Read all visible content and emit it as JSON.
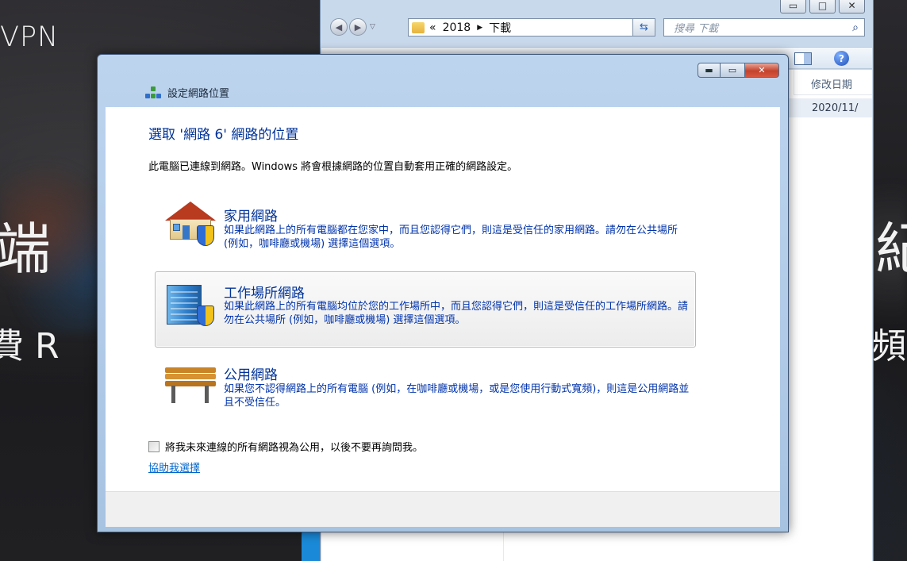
{
  "background": {
    "page_text_vpn": "VPN",
    "page_text_big_left": "端",
    "page_text_fee_left": "費 R",
    "page_text_big_right": "紀",
    "page_text_fee_right": "頻"
  },
  "explorer": {
    "address_prefix": "«",
    "crumbs": [
      "2018",
      "下載"
    ],
    "search_placeholder": "搜尋 下載",
    "column_header": "修改日期",
    "row_date": "2020/11/"
  },
  "dialog": {
    "title": "設定網路位置",
    "heading": "選取 '網路  6' 網路的位置",
    "intro": "此電腦已連線到網路。Windows 將會根據網路的位置自動套用正確的網路設定。",
    "options": [
      {
        "title": "家用網路",
        "desc": "如果此網路上的所有電腦都在您家中，而且您認得它們，則這是受信任的家用網路。請勿在公共場所 (例如，咖啡廳或機場) 選擇這個選項。",
        "icon": "home-network-icon"
      },
      {
        "title": "工作場所網路",
        "desc": "如果此網路上的所有電腦均位於您的工作場所中，而且您認得它們，則這是受信任的工作場所網路。請勿在公共場所 (例如，咖啡廳或機場) 選擇這個選項。",
        "icon": "work-network-icon"
      },
      {
        "title": "公用網路",
        "desc": "如果您不認得網路上的所有電腦 (例如，在咖啡廳或機場，或是您使用行動式寬頻)，則這是公用網路並且不受信任。",
        "icon": "public-network-icon"
      }
    ],
    "checkbox_label": "將我未來連線的所有網路視為公用，以後不要再詢問我。",
    "help_link": "協助我選擇"
  },
  "colors": {
    "heading_blue": "#003399",
    "link_blue": "#0066cc",
    "close_red": "#c4422d"
  }
}
